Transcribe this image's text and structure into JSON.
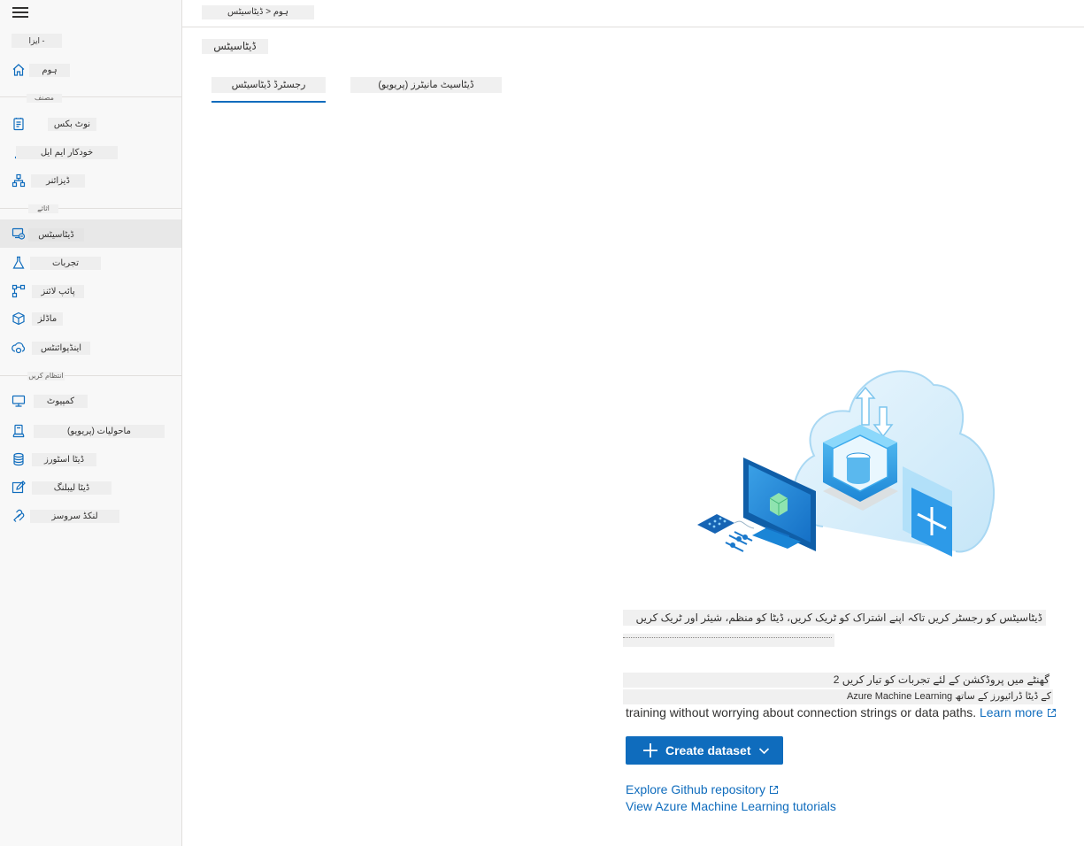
{
  "header": {
    "breadcrumb": "ہوم < ڈیٹاسیٹس",
    "page_title": "ڈیٹاسیٹس"
  },
  "sidebar": {
    "workspace": "ایزا -",
    "home": "ہوم",
    "section_author": "مصنف",
    "author_items": [
      "نوٹ بکس",
      "خودکار ایم ایل",
      "ڈیزائنر"
    ],
    "section_assets": "اثاثے",
    "asset_items": [
      "ڈیٹاسیٹس",
      "تجربات",
      "پائپ لائنز",
      "ماڈلز",
      "اینڈپوائنٹس"
    ],
    "section_manage": "انتظام کریں",
    "manage_items": [
      "کمپیوٹ",
      "ماحولیات (پریویو)",
      "ڈیٹا اسٹورز",
      "ڈیٹا لیبلنگ",
      "لنکڈ سروسز"
    ]
  },
  "tabs": {
    "registered": "رجسٹرڈ ڈیٹاسیٹس",
    "monitors": "ڈیٹاسیٹ مانیٹرز (پریویو)"
  },
  "empty_state": {
    "line1": "ڈیٹاسیٹس کو رجسٹر کریں تاکہ اپنے اشتراک کو ٹریک کریں، ڈیٹا کو منظم، شیئر اور ٹریک کریں",
    "para1": "گھنٹے میں پروڈکشن کے لئے تجربات کو تیار کریں 2",
    "para2": "Azure Machine Learning کے ڈیٹا ڈرائیورز کے ساتھ",
    "para3": "training without worrying about connection strings or data paths.",
    "learn_more": "Learn more",
    "create_button": "Create dataset",
    "link_github": "Explore Github repository",
    "link_tutorials": "View Azure Machine Learning tutorials"
  },
  "colors": {
    "accent": "#0f6cbd",
    "sidebar_bg": "#f8f8f8",
    "active_item_bg": "#e8e8e8"
  },
  "icons": {
    "nav": [
      "home-icon",
      "notebook-icon",
      "automl-icon",
      "designer-icon",
      "datasets-icon",
      "experiments-icon",
      "pipelines-icon",
      "models-icon",
      "endpoints-icon",
      "compute-icon",
      "environments-icon",
      "datastores-icon",
      "labeling-icon",
      "linked-services-icon"
    ]
  }
}
